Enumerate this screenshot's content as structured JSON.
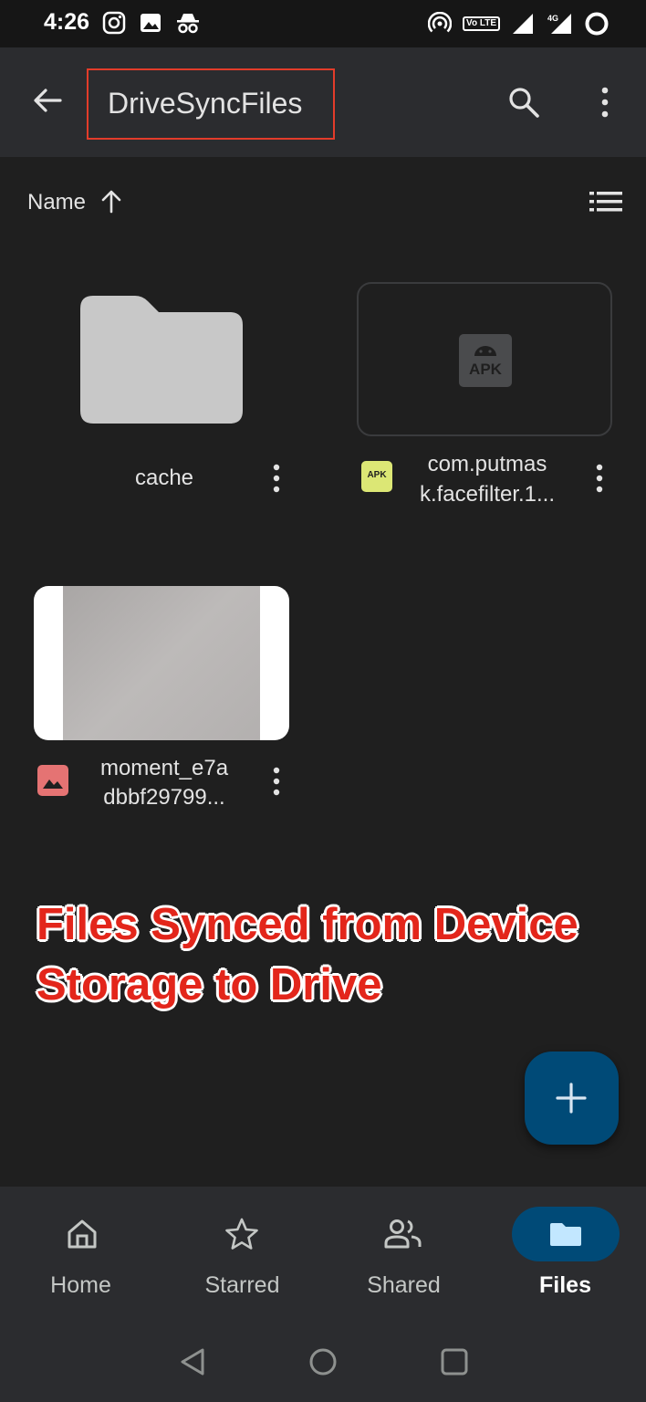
{
  "status_bar": {
    "time": "4:26",
    "volte_label": "Vo LTE",
    "network_label": "4G"
  },
  "header": {
    "title": "DriveSyncFiles",
    "back_icon": "arrow-back-icon",
    "search_icon": "search-icon",
    "more_icon": "more-vert-icon",
    "highlight_color": "#e33c2a"
  },
  "sort": {
    "label": "Name",
    "direction_icon": "arrow-upward-icon",
    "view_icon": "list-view-icon"
  },
  "files": [
    {
      "name": "cache",
      "type": "folder"
    },
    {
      "name_line1": "com.putmas",
      "name_line2": "k.facefilter.1...",
      "type": "apk",
      "thumb_label": "APK",
      "badge_label": "APK"
    },
    {
      "name_line1": "moment_e7a",
      "name_line2": "dbbf29799...",
      "type": "image"
    }
  ],
  "annotation": {
    "caption_line1": "Files Synced from Device",
    "caption_line2": "Storage to Drive",
    "color": "#e3261b"
  },
  "fab": {
    "icon": "plus-icon",
    "color": "#004a77"
  },
  "bottom_nav": {
    "items": [
      {
        "label": "Home",
        "icon": "home-icon"
      },
      {
        "label": "Starred",
        "icon": "star-icon"
      },
      {
        "label": "Shared",
        "icon": "shared-people-icon"
      },
      {
        "label": "Files",
        "icon": "folder-icon",
        "active": true
      }
    ],
    "active_pill_color": "#004a77"
  }
}
